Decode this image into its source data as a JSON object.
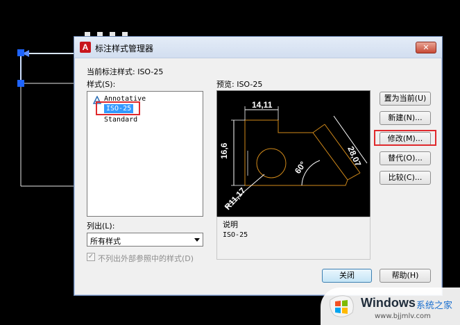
{
  "dialog": {
    "title": "标注样式管理器",
    "close_label": "✕",
    "current_style_label": "当前标注样式: ISO-25",
    "styles_label": "样式(S):",
    "preview_label": "预览: ISO-25",
    "styles": [
      "Annotative",
      "ISO-25",
      "Standard"
    ],
    "selected_style": "ISO-25",
    "list_label": "列出(L):",
    "list_value": "所有样式",
    "exclude_xref_label": "不列出外部参照中的样式(D)",
    "exclude_xref_checked": true,
    "description_label": "说明",
    "description_value": "ISO-25",
    "buttons": {
      "set_current": "置为当前(U)",
      "new": "新建(N)...",
      "modify": "修改(M)...",
      "override": "替代(O)...",
      "compare": "比较(C)...",
      "close": "关闭",
      "help": "帮助(H)"
    }
  },
  "preview_dims": {
    "top": "14,11",
    "left": "16,6",
    "right": "28,07",
    "angle": "60°",
    "radius": "R11,17"
  },
  "watermark": {
    "title": "Windows",
    "subtitle": "系统之家",
    "url": "www.bjjmlv.com"
  },
  "colors": {
    "highlight": "#e0292c",
    "selection": "#3399ff",
    "accent_icon": "#c8161d",
    "cad_line": "#ffffff",
    "cad_grip": "#1e64ff"
  }
}
